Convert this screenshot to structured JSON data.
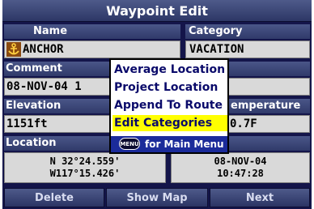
{
  "title": "Waypoint Edit",
  "name": {
    "label": "Name",
    "value": "ANCHOR",
    "icon": "anchor-icon"
  },
  "category": {
    "label": "Category",
    "value": "VACATION"
  },
  "comment": {
    "label": "Comment",
    "value": "08-NOV-04 1"
  },
  "elevation": {
    "label": "Elevation",
    "value": "1151ft"
  },
  "temperature": {
    "label": "emperature",
    "value": "0.7F"
  },
  "location": {
    "label": "Location",
    "lat": "N  32°24.559'",
    "lon": "W117°15.426'"
  },
  "datetime": {
    "date": "08-NOV-04",
    "time": "10:47:28"
  },
  "menu": {
    "items": [
      "Average Location",
      "Project Location",
      "Append To Route",
      "Edit Categories"
    ],
    "selected_index": 3,
    "footer_icon": "MENU",
    "footer_text": "for Main Menu"
  },
  "buttons": {
    "delete": "Delete",
    "show_map": "Show Map",
    "next": "Next"
  },
  "colors": {
    "background": "#14154a",
    "highlight": "#ffff00",
    "field": "#d9d9d9",
    "menu_footer": "#1b2b9a"
  }
}
